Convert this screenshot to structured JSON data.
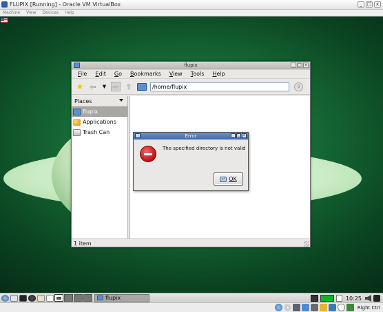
{
  "vbox": {
    "title": "FLUPIX [Running] - Oracle VM VirtualBox",
    "menu": [
      "Machine",
      "View",
      "Devices",
      "Help"
    ],
    "window_buttons": [
      "_",
      "□",
      "x"
    ],
    "host_key": "Right Ctrl"
  },
  "file_manager": {
    "title": "flupix",
    "window_buttons": [
      "_",
      "□",
      "x"
    ],
    "menu": [
      "File",
      "Edit",
      "Go",
      "Bookmarks",
      "View",
      "Tools",
      "Help"
    ],
    "path": "/home/flupix",
    "places_header": "Places",
    "places": [
      {
        "label": "flupix",
        "icon": "home-folder-icon",
        "selected": true
      },
      {
        "label": "Applications",
        "icon": "applications-icon",
        "selected": false
      },
      {
        "label": "Trash Can",
        "icon": "trash-icon",
        "selected": false
      }
    ],
    "status": "1 item"
  },
  "error_dialog": {
    "title": "Error",
    "window_buttons": [
      "_",
      "□",
      "x"
    ],
    "message": "The specified directory is not valid",
    "ok_label": "OK"
  },
  "taskbar": {
    "task_label": "flupix",
    "clock": "10:25"
  },
  "colors": {
    "desktop_dark": "#0a4321",
    "dialog_titlebar": "#4f78b3",
    "error_icon": "#c01111",
    "selection": "#a8a7a4"
  }
}
